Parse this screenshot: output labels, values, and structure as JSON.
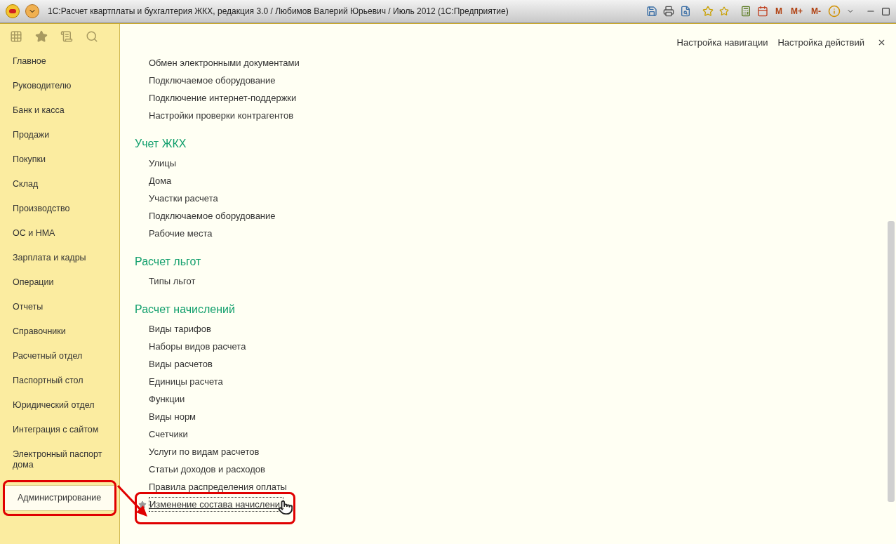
{
  "window": {
    "title": "1С:Расчет квартплаты и бухгалтерия ЖКХ, редакция 3.0 / Любимов Валерий Юрьевич / Июль 2012  (1С:Предприятие)",
    "memory_buttons": [
      "M",
      "M+",
      "M-"
    ]
  },
  "sidebar": {
    "items": [
      {
        "label": "Главное",
        "selected": false
      },
      {
        "label": "Руководителю",
        "selected": false
      },
      {
        "label": "Банк и касса",
        "selected": false
      },
      {
        "label": "Продажи",
        "selected": false
      },
      {
        "label": "Покупки",
        "selected": false
      },
      {
        "label": "Склад",
        "selected": false
      },
      {
        "label": "Производство",
        "selected": false
      },
      {
        "label": "ОС и НМА",
        "selected": false
      },
      {
        "label": "Зарплата и кадры",
        "selected": false
      },
      {
        "label": "Операции",
        "selected": false
      },
      {
        "label": "Отчеты",
        "selected": false
      },
      {
        "label": "Справочники",
        "selected": false
      },
      {
        "label": "Расчетный отдел",
        "selected": false
      },
      {
        "label": "Паспортный стол",
        "selected": false
      },
      {
        "label": "Юридический отдел",
        "selected": false
      },
      {
        "label": "Интеграция с сайтом",
        "selected": false
      },
      {
        "label": "Электронный паспорт дома",
        "selected": false
      },
      {
        "label": "Администрирование",
        "selected": true,
        "highlighted": true
      }
    ]
  },
  "header_links": [
    "Настройка навигации",
    "Настройка действий"
  ],
  "sections": [
    {
      "items": [
        {
          "label": "Обмен электронными документами"
        },
        {
          "label": "Подключаемое оборудование"
        },
        {
          "label": "Подключение интернет-поддержки"
        },
        {
          "label": "Настройки проверки контрагентов"
        }
      ]
    },
    {
      "title": "Учет ЖКХ",
      "items": [
        {
          "label": "Улицы"
        },
        {
          "label": "Дома"
        },
        {
          "label": "Участки расчета"
        },
        {
          "label": "Подключаемое оборудование"
        },
        {
          "label": "Рабочие места"
        }
      ]
    },
    {
      "title": "Расчет льгот",
      "items": [
        {
          "label": "Типы льгот"
        }
      ]
    },
    {
      "title": "Расчет начислений",
      "items": [
        {
          "label": "Виды тарифов"
        },
        {
          "label": "Наборы видов расчета"
        },
        {
          "label": "Виды расчетов"
        },
        {
          "label": "Единицы расчета"
        },
        {
          "label": "Функции"
        },
        {
          "label": "Виды норм"
        },
        {
          "label": "Счетчики"
        },
        {
          "label": "Услуги по видам расчетов"
        },
        {
          "label": "Статьи доходов и расходов"
        },
        {
          "label": "Правила распределения оплаты"
        },
        {
          "label": "Изменение состава начислени",
          "focused": true,
          "highlighted": true
        }
      ]
    }
  ]
}
